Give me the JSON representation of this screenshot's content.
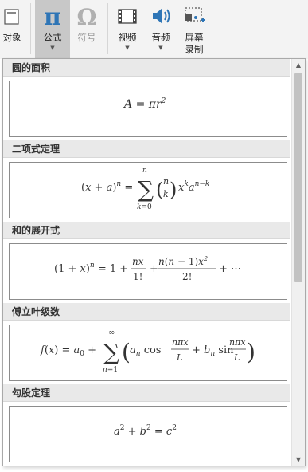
{
  "ribbon": {
    "object_label": "对象",
    "equation_label": "公式",
    "symbol_label": "符号",
    "video_label": "视频",
    "audio_label": "音频",
    "screen_record_label": "屏幕\n录制",
    "icons": {
      "object": "object-icon",
      "equation": "pi-icon",
      "symbol": "omega-icon",
      "video": "film-icon",
      "audio": "speaker-icon",
      "screen_record": "screen-recording-icon"
    }
  },
  "gallery": {
    "categories": [
      {
        "title": "圆的面积",
        "equation": "A = πr²"
      },
      {
        "title": "二项式定理",
        "equation": "(x + a)ⁿ = Σ_{k=0}^{n} (n k) xᵏ aⁿ⁻ᵏ"
      },
      {
        "title": "和的展开式",
        "equation": "(1 + x)ⁿ = 1 + nx/1! + n(n − 1)x²/2! + ⋯"
      },
      {
        "title": "傅立叶级数",
        "equation": "f(x) = a₀ + Σ_{n=1}^{∞} (aₙ cos nπx/L + bₙ sin nπx/L)"
      },
      {
        "title": "勾股定理",
        "equation": "a² + b² = c²"
      }
    ],
    "scrollbar": {
      "up_arrow": "▲",
      "down_arrow": "▼"
    }
  },
  "colors": {
    "ribbon_bg": "#f3f3f3",
    "active_button_bg": "#c8c8c8",
    "pi_blue": "#2e75b6",
    "header_bg": "#e9e9e9",
    "card_border": "#8c8c8c",
    "scroll_thumb": "#c2c2c2"
  }
}
